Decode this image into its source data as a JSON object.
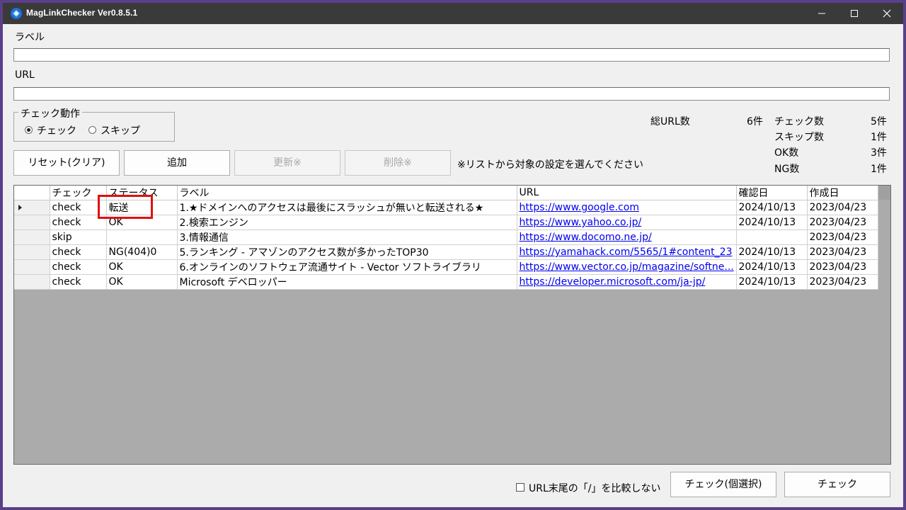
{
  "window": {
    "title": "MagLinkChecker Ver0.8.5.1"
  },
  "form": {
    "label_caption": "ラベル",
    "label_value": "",
    "url_caption": "URL",
    "url_value": ""
  },
  "check_action": {
    "legend": "チェック動作",
    "options": [
      {
        "label": "チェック",
        "selected": true
      },
      {
        "label": "スキップ",
        "selected": false
      }
    ]
  },
  "buttons": {
    "reset": "リセット(クリア)",
    "add": "追加",
    "update": "更新※",
    "delete": "削除※",
    "hint": "※リストから対象の設定を選んでください",
    "check_selected": "チェック(個選択)",
    "check": "チェック"
  },
  "stats": {
    "total_label": "総URL数",
    "total_value": "6件",
    "check_label": "チェック数",
    "check_value": "5件",
    "skip_label": "スキップ数",
    "skip_value": "1件",
    "ok_label": "OK数",
    "ok_value": "3件",
    "ng_label": "NG数",
    "ng_value": "1件"
  },
  "grid": {
    "columns": [
      "チェック",
      "ステータス",
      "ラベル",
      "URL",
      "確認日",
      "作成日"
    ],
    "rows": [
      {
        "check": "check",
        "status": "転送",
        "label": "1.★ドメインへのアクセスは最後にスラッシュが無いと転送される★",
        "url": "https://www.google.com",
        "checked": "2024/10/13",
        "created": "2023/04/23"
      },
      {
        "check": "check",
        "status": "OK",
        "label": "2.検索エンジン",
        "url": "https://www.yahoo.co.jp/",
        "checked": "2024/10/13",
        "created": "2023/04/23"
      },
      {
        "check": "skip",
        "status": "",
        "label": "3.情報通信",
        "url": "https://www.docomo.ne.jp/",
        "checked": "",
        "created": "2023/04/23"
      },
      {
        "check": "check",
        "status": "NG(404)0",
        "label": "5.ランキング - アマゾンのアクセス数が多かったTOP30",
        "url": "https://yamahack.com/5565/1#content_23",
        "checked": "2024/10/13",
        "created": "2023/04/23"
      },
      {
        "check": "check",
        "status": "OK",
        "label": "6.オンラインのソフトウェア流通サイト - Vector ソフトライブラリ",
        "url": "https://www.vector.co.jp/magazine/softne...",
        "checked": "2024/10/13",
        "created": "2023/04/23"
      },
      {
        "check": "check",
        "status": "OK",
        "label": "Microsoft デベロッパー",
        "url": "https://developer.microsoft.com/ja-jp/",
        "checked": "2024/10/13",
        "created": "2023/04/23"
      }
    ]
  },
  "options": {
    "trailing_slash_label": "URL末尾の「/」を比較しない",
    "trailing_slash_checked": false
  },
  "colors": {
    "titlebar": "#3a3a3a",
    "highlight": "#e01010",
    "link": "#0000ee"
  }
}
